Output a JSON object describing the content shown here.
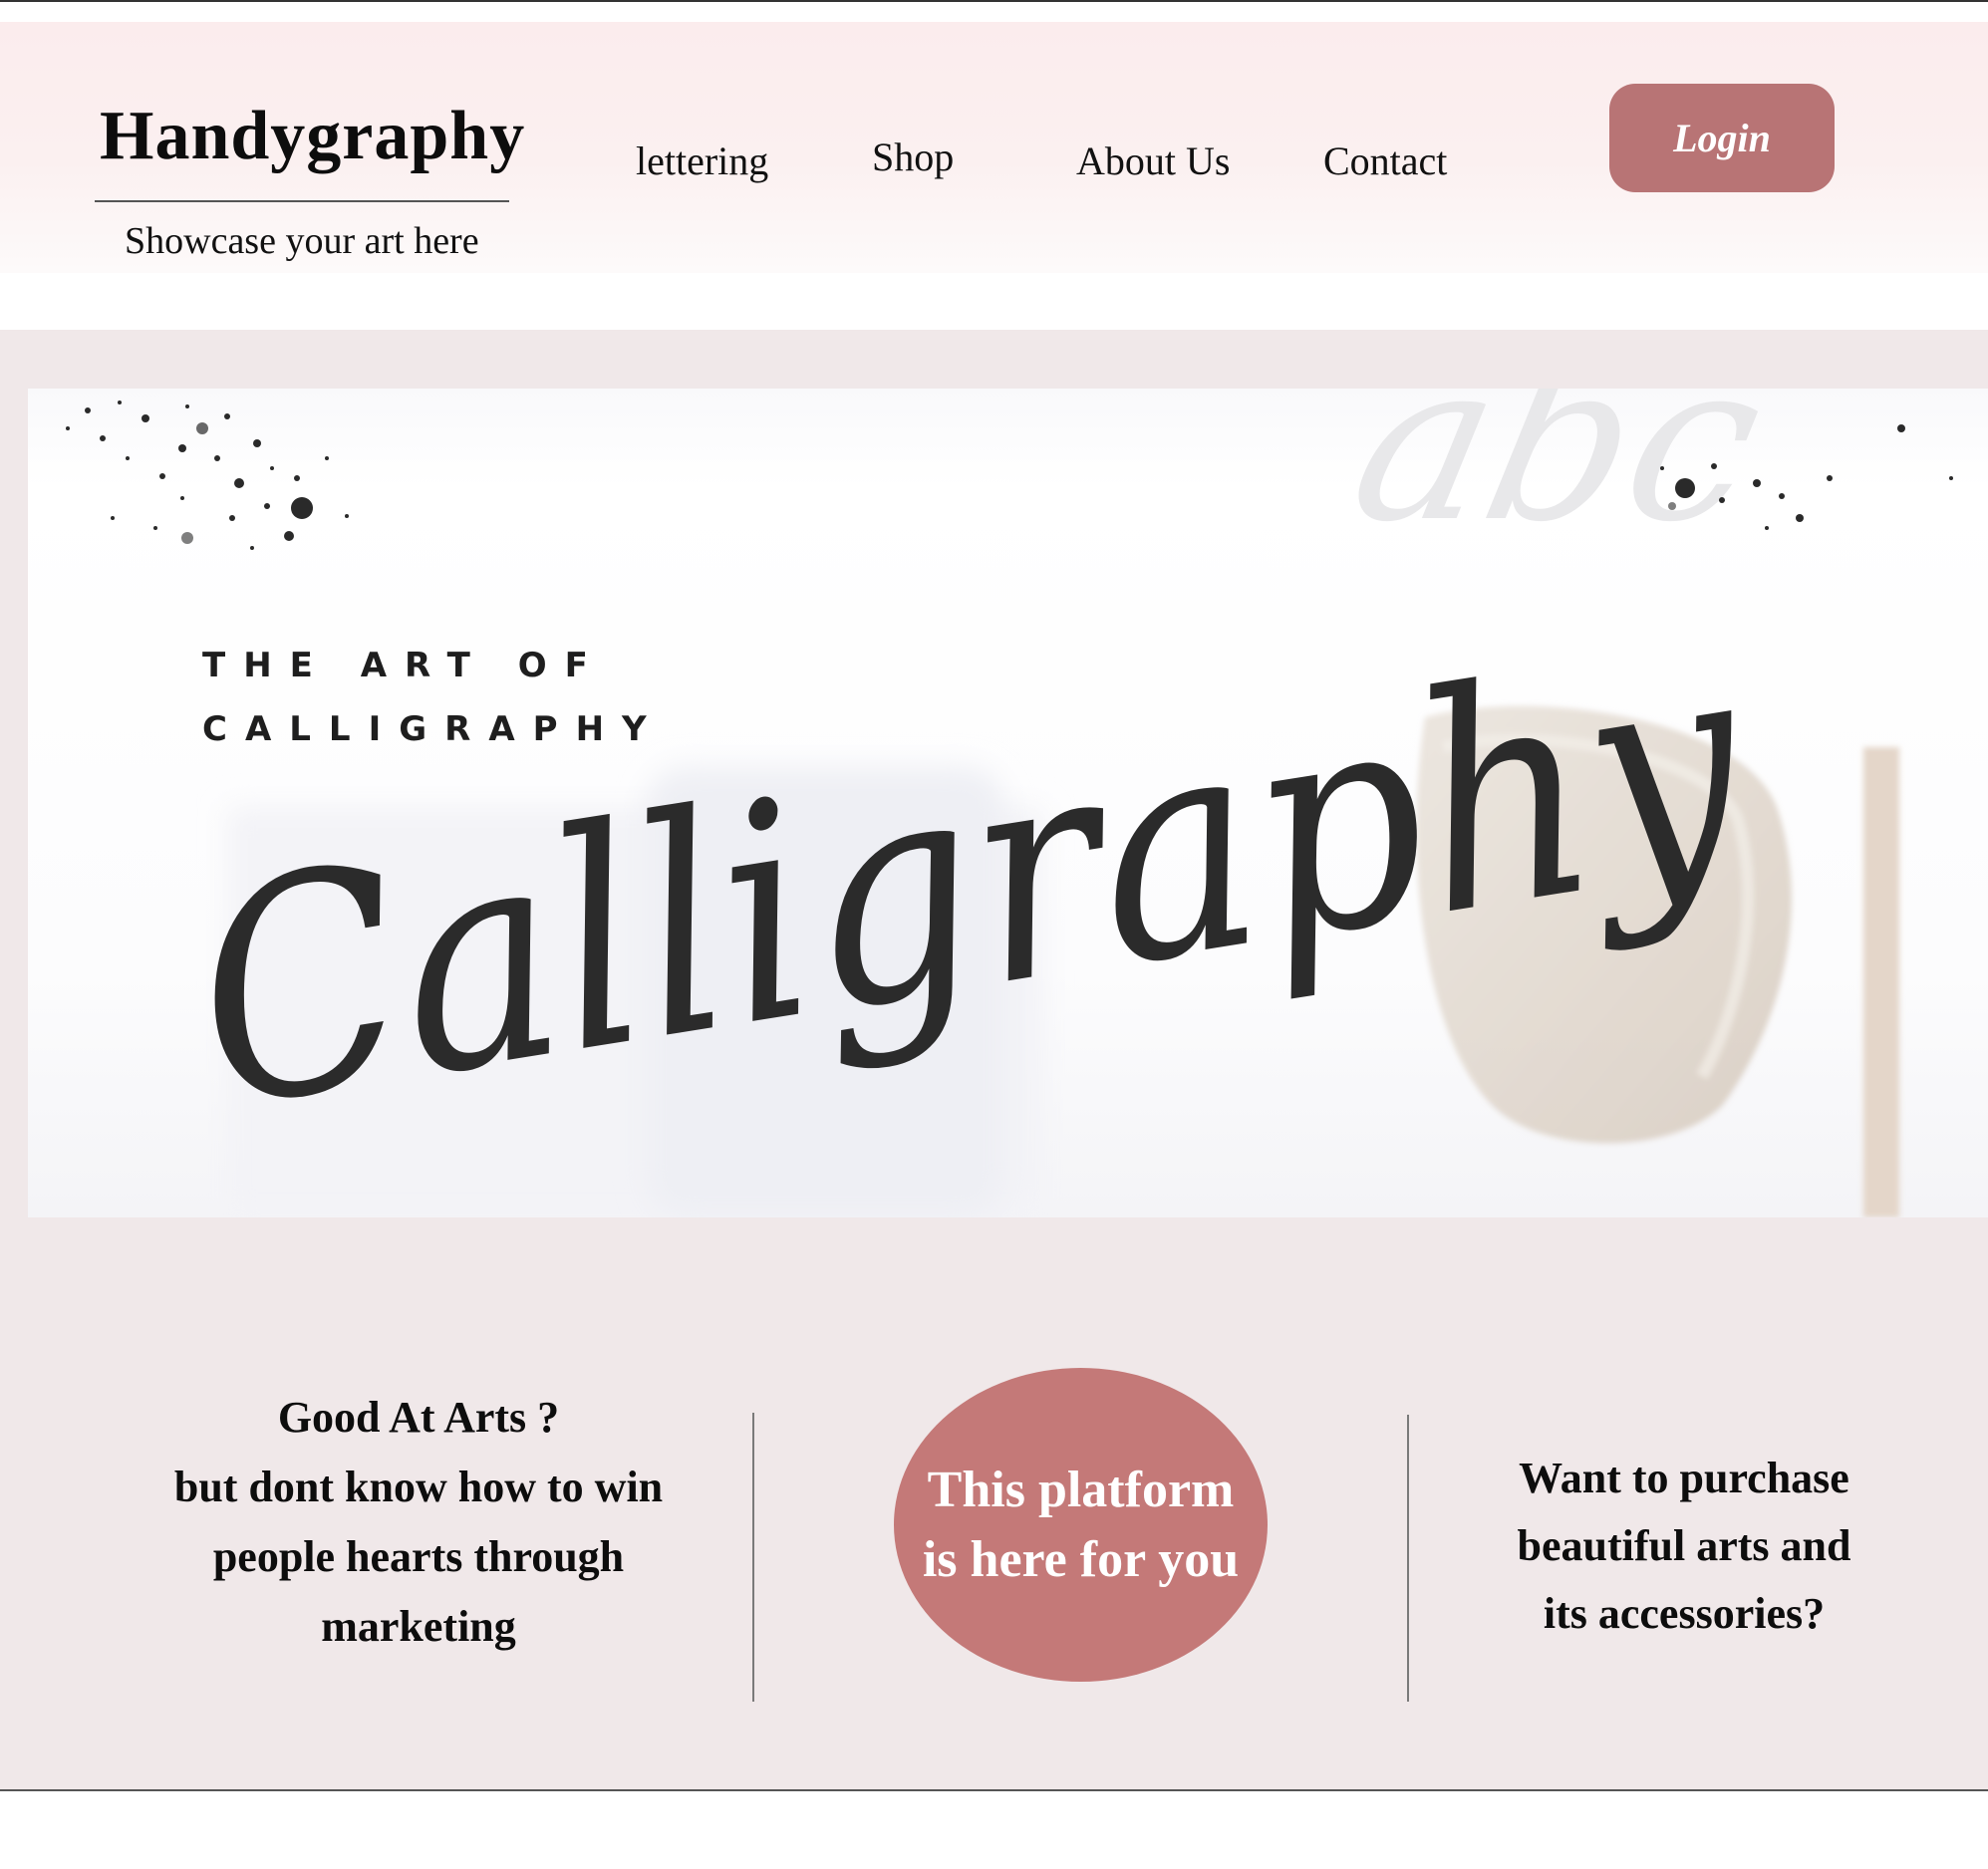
{
  "header": {
    "brand_title": "Handygraphy",
    "tagline": "Showcase your art here",
    "nav": [
      {
        "label": "lettering"
      },
      {
        "label": "Shop"
      },
      {
        "label": "About Us"
      },
      {
        "label": "Contact"
      }
    ],
    "login_label": "Login"
  },
  "hero": {
    "kicker_line1": "THE ART OF",
    "kicker_line2": "CALLIGRAPHY",
    "script_word": "Calligraphy",
    "watermark": "abc"
  },
  "info": {
    "left_lines": [
      "Good At Arts ?",
      "but dont know how to win",
      "people hearts through",
      "marketing"
    ],
    "center_text": "This platform is here for you",
    "right_lines": [
      "Want to purchase",
      "beautiful arts and",
      "its accessories?"
    ]
  },
  "colors": {
    "accent_login": "#b87475",
    "accent_circle": "#c47978",
    "band_background": "#f0e8e9",
    "header_background": "#fbeced"
  }
}
